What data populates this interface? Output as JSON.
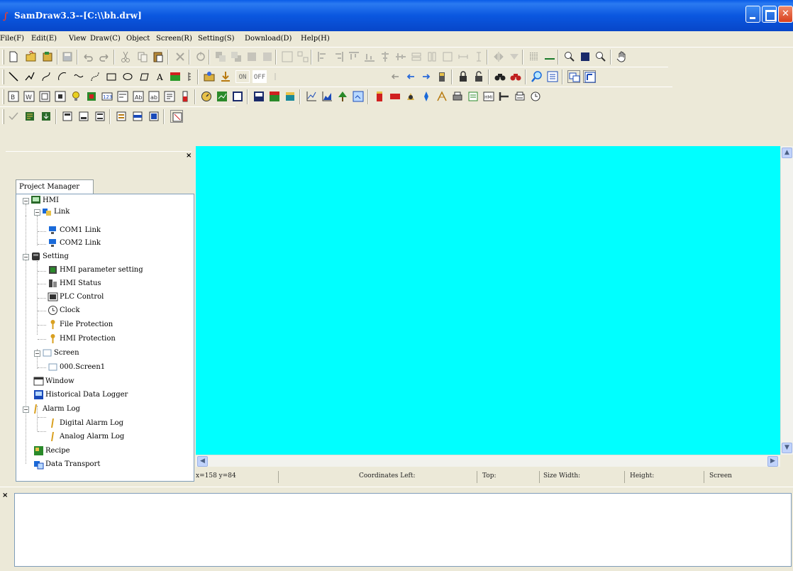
{
  "window": {
    "title": "SamDraw3.3--[C:\\\\bh.drw]",
    "app_icon": "samdraw-logo-icon"
  },
  "menu": [
    "File(F)",
    "Edit(E)",
    "View",
    "Draw(C)",
    "Object",
    "Screen(R)",
    "Setting(S)",
    "Download(D)",
    "Help(H)"
  ],
  "toolbar": {
    "on_label": "ON",
    "off_label": "OFF"
  },
  "project_manager": {
    "tab_label": "Project Manager",
    "close_glyph": "×",
    "tree": {
      "root": "HMI",
      "link": "Link",
      "com1": "COM1 Link",
      "com2": "COM2 Link",
      "setting": "Setting",
      "hmi_param": "HMI parameter setting",
      "hmi_status": "HMI Status",
      "plc_control": "PLC Control",
      "clock": "Clock",
      "file_protection": "File Protection",
      "hmi_protection": "HMI Protection",
      "screen": "Screen",
      "screen1": "000.Screen1",
      "window": "Window",
      "hist_logger": "Historical Data Logger",
      "alarm_log": "Alarm Log",
      "digital_alarm": "Digital Alarm Log",
      "analog_alarm": "Analog Alarm Log",
      "recipe": "Recipe",
      "data_transport": "Data Transport"
    }
  },
  "canvas": {
    "background": "#00ffff"
  },
  "statusbar": {
    "cursor": "x=158 y=84",
    "coordinates_left": "Coordinates Left:",
    "top": "Top:",
    "size_width": "Size Width:",
    "height": "Height:",
    "screen": "Screen"
  },
  "output": {
    "close_glyph": "×"
  }
}
